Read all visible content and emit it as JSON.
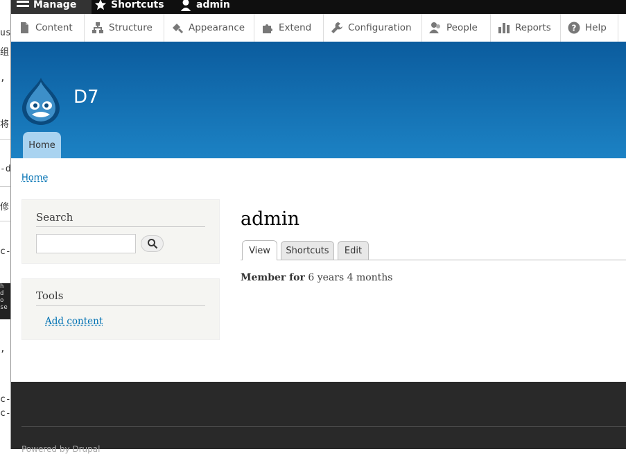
{
  "toolbar": {
    "top": [
      {
        "label": "Manage",
        "icon": "menu-icon"
      },
      {
        "label": "Shortcuts",
        "icon": "star-icon"
      },
      {
        "label": "admin",
        "icon": "user-icon"
      }
    ],
    "tray": [
      {
        "label": "Content",
        "icon": "file-icon"
      },
      {
        "label": "Structure",
        "icon": "structure-icon"
      },
      {
        "label": "Appearance",
        "icon": "paintbrush-icon"
      },
      {
        "label": "Extend",
        "icon": "puzzle-icon"
      },
      {
        "label": "Configuration",
        "icon": "wrench-icon"
      },
      {
        "label": "People",
        "icon": "people-icon"
      },
      {
        "label": "Reports",
        "icon": "bar-chart-icon"
      },
      {
        "label": "Help",
        "icon": "question-icon"
      }
    ]
  },
  "header": {
    "site_name": "D7",
    "home_tab": "Home"
  },
  "breadcrumb": {
    "home": "Home"
  },
  "sidebar": {
    "search": {
      "title": "Search",
      "input_value": ""
    },
    "tools": {
      "title": "Tools",
      "link": "Add content"
    }
  },
  "main": {
    "title": "admin",
    "tabs": [
      {
        "label": "View",
        "active": true
      },
      {
        "label": "Shortcuts",
        "active": false
      },
      {
        "label": "Edit",
        "active": false
      }
    ],
    "member_label": "Member for",
    "member_value": "6 years 4 months"
  },
  "footer": {
    "text": "Powered by Drupal"
  },
  "colors": {
    "header_top": "#0b5c9e",
    "header_bottom": "#1c82c4",
    "link": "#0071b3",
    "footer": "#292929"
  }
}
